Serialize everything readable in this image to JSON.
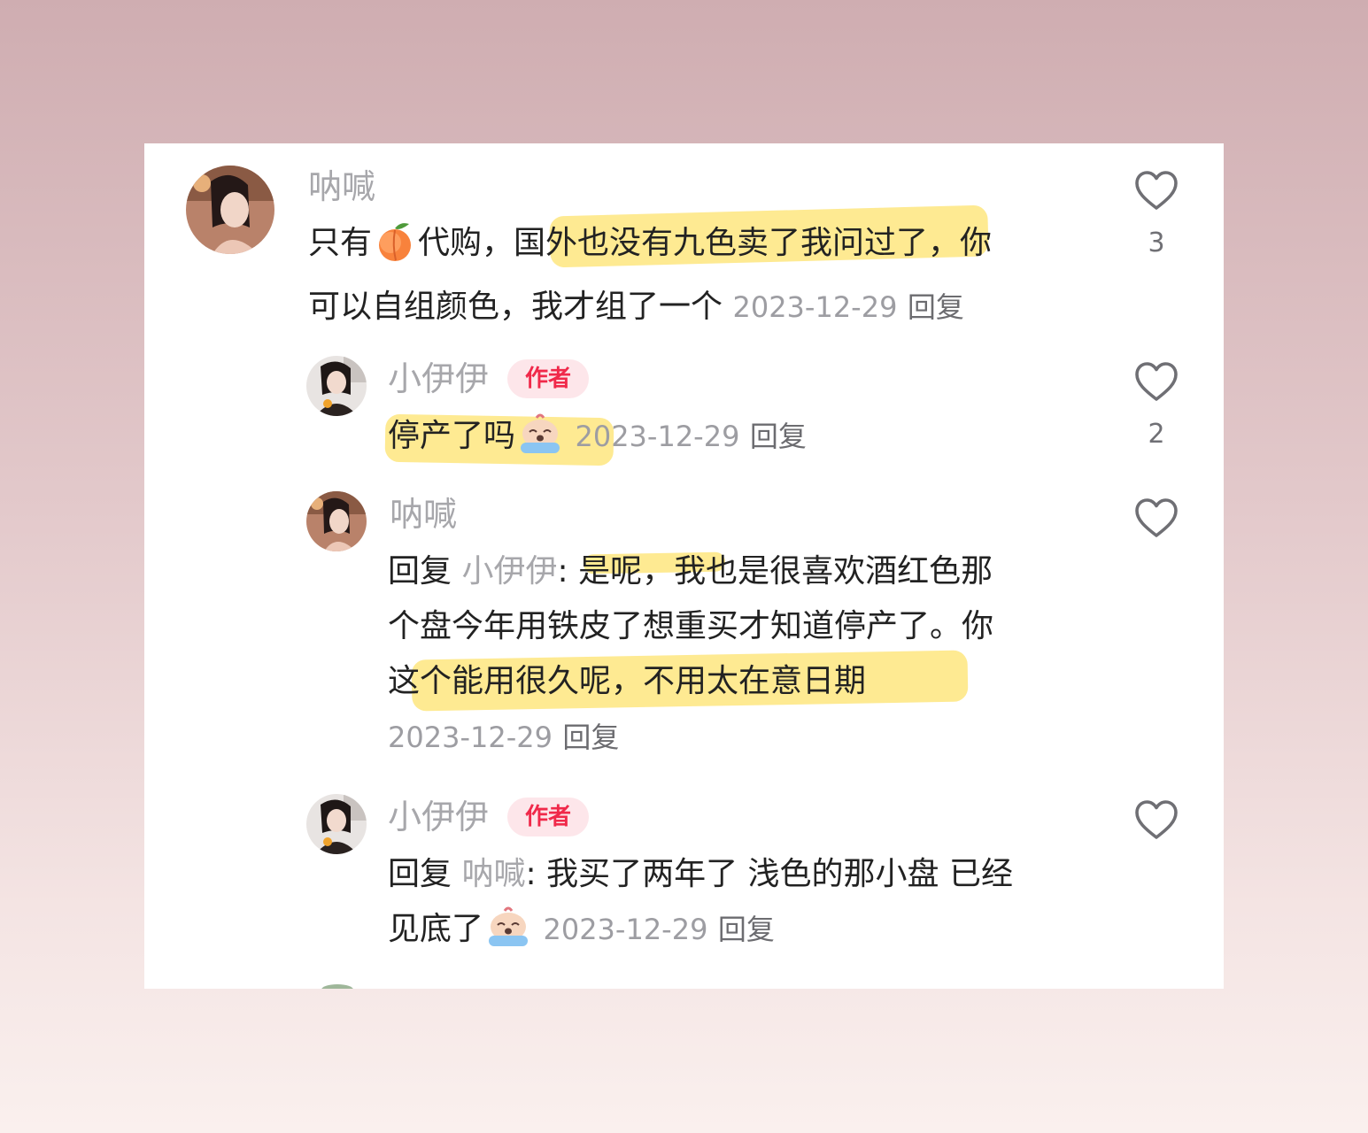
{
  "comments": [
    {
      "username": "呐喊",
      "text_a": "只有",
      "emoji_a": "peach-icon",
      "text_b": "代购，国外也没有九色卖了我问过了，你",
      "text_c": "可以自组颜色，我才组了一个",
      "date": "2023-12-29",
      "reply_label": "回复",
      "likes": "3"
    },
    {
      "username": "小伊伊",
      "badge": "作者",
      "text_a": "停产了吗",
      "emoji_a": "crying-emoji-icon",
      "date": "2023-12-29",
      "reply_label": "回复",
      "likes": "2"
    },
    {
      "username": "呐喊",
      "reply_prefix": "回复",
      "mention": "小伊伊",
      "colon": ":",
      "line1": " 是呢，我也是很喜欢酒红色那",
      "line2": "个盘今年用铁皮了想重买才知道停产了。你",
      "line3": "这个能用很久呢，不用太在意日期",
      "date": "2023-12-29",
      "reply_label": "回复"
    },
    {
      "username": "小伊伊",
      "badge": "作者",
      "reply_prefix": "回复",
      "mention": "呐喊",
      "colon": ":",
      "line1": " 我买了两年了 浅色的那小盘 已经",
      "line2": "见底了",
      "emoji_a": "crying-emoji-icon",
      "date": "2023-12-29",
      "reply_label": "回复"
    }
  ],
  "colors": {
    "highlight": "#fee268",
    "badge_bg": "#fde6ea",
    "badge_text": "#f0294a",
    "meta": "#9d9da2"
  }
}
